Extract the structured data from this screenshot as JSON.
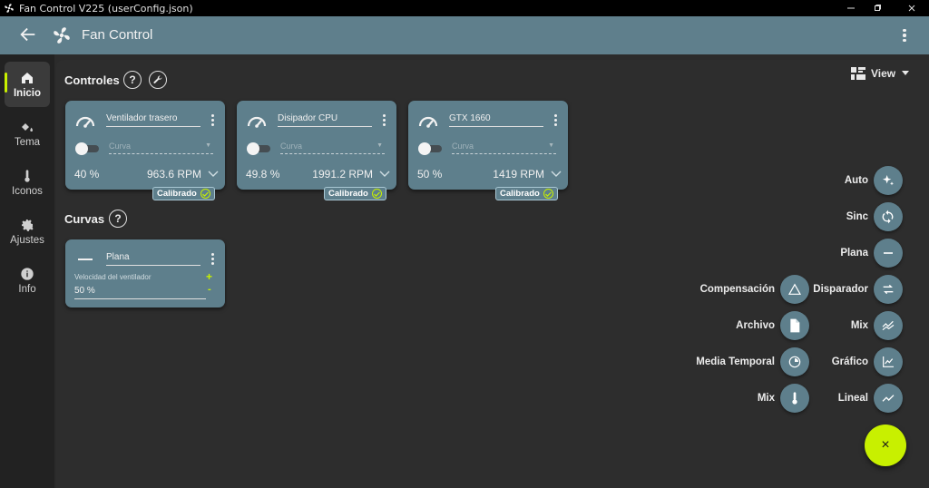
{
  "window": {
    "title": "Fan Control V225 (userConfig.json)",
    "controls": [
      "minimize-icon",
      "maximize-icon",
      "close-icon"
    ]
  },
  "appbar": {
    "title": "Fan Control",
    "icons": [
      "back-arrow-icon",
      "fan-icon",
      "more-vert-icon"
    ]
  },
  "nav": {
    "items": [
      {
        "label": "Inicio",
        "icon": "home-icon",
        "active": true
      },
      {
        "label": "Tema",
        "icon": "paint-bucket-icon",
        "active": false
      },
      {
        "label": "Iconos",
        "icon": "thermometer-icon",
        "active": false
      },
      {
        "label": "Ajustes",
        "icon": "gear-icon",
        "active": false
      },
      {
        "label": "Info",
        "icon": "info-icon",
        "active": false
      }
    ]
  },
  "controls_section": {
    "title": "Controles",
    "help": "?",
    "view_label": "View",
    "cards": [
      {
        "name": "Ventilador trasero",
        "curve_placeholder": "Curva",
        "percent": "40 %",
        "rpm": "963.6 RPM",
        "badge": "Calibrado"
      },
      {
        "name": "Disipador CPU",
        "curve_placeholder": "Curva",
        "percent": "49.8 %",
        "rpm": "1991.2 RPM",
        "badge": "Calibrado"
      },
      {
        "name": "GTX 1660",
        "curve_placeholder": "Curva",
        "percent": "50 %",
        "rpm": "1419 RPM",
        "badge": "Calibrado"
      }
    ]
  },
  "curves_section": {
    "title": "Curvas",
    "help": "?",
    "card": {
      "name": "Plana",
      "speed_label": "Velocidad del ventilador",
      "speed_value": "50 %",
      "plus": "+",
      "minus": "-"
    }
  },
  "speed_dial": {
    "right": [
      "Auto",
      "Sinc",
      "Plana",
      "Disparador",
      "Mix",
      "Gráfico",
      "Lineal"
    ],
    "left": [
      "Compensación",
      "Archivo",
      "Media Temporal",
      "Mix"
    ],
    "close": "×"
  },
  "colors": {
    "accent": "#c8f000",
    "card": "#5e7f8c",
    "appbar": "#5f7f8c"
  }
}
